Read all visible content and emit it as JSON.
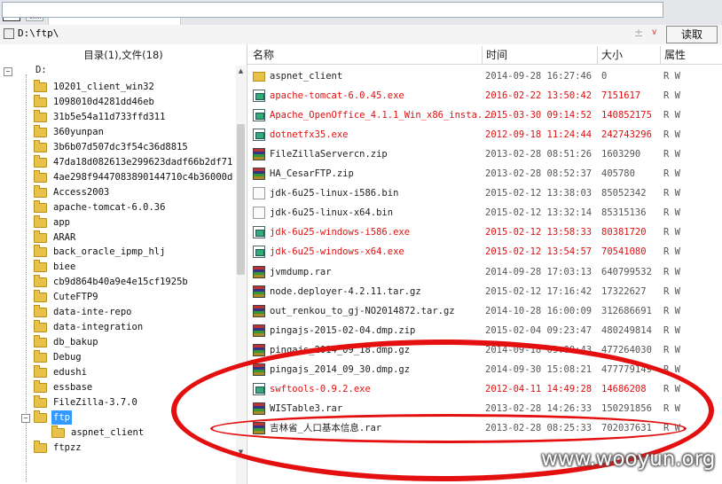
{
  "address": {
    "path": "D:\\ftp\\",
    "read_label": "读取"
  },
  "tree": {
    "header": "目录(1),文件(18)",
    "root_label": "D:",
    "folders": [
      "10201_client_win32",
      "1098010d4281dd46eb",
      "31b5e54a11d733ffd311",
      "360yunpan",
      "3b6b07d507dc3f54c36d8815",
      "47da18d082613e299623dadf66b2df71",
      "4ae298f9447083890144710c4b36000d",
      "Access2003",
      "apache-tomcat-6.0.36",
      "app",
      "ARAR",
      "back_oracle_ipmp_hlj",
      "biee",
      "cb9d864b40a9e4e15cf1925b",
      "CuteFTP9",
      "data-inte-repo",
      "data-integration",
      "db_bakup",
      "Debug",
      "edushi",
      "essbase",
      "FileZilla-3.7.0",
      "ftp",
      "aspnet_client",
      "ftpzz"
    ],
    "selected": "ftp"
  },
  "list": {
    "headers": {
      "name": "名称",
      "time": "时间",
      "size": "大小",
      "attr": "属性"
    },
    "rows": [
      {
        "name": "aspnet_client",
        "time": "2014-09-28 16:27:46",
        "size": "0",
        "attr": "R W",
        "icon": "folder-icon",
        "red": false
      },
      {
        "name": "apache-tomcat-6.0.45.exe",
        "time": "2016-02-22 13:50:42",
        "size": "7151617",
        "attr": "R W",
        "icon": "exe-icon",
        "red": true
      },
      {
        "name": "Apache_OpenOffice_4.1.1_Win_x86_insta...",
        "time": "2015-03-30 09:14:52",
        "size": "140852175",
        "attr": "R W",
        "icon": "exe-icon",
        "red": true
      },
      {
        "name": "dotnetfx35.exe",
        "time": "2012-09-18 11:24:44",
        "size": "242743296",
        "attr": "R W",
        "icon": "exe-icon",
        "red": true
      },
      {
        "name": "FileZillaServercn.zip",
        "time": "2013-02-28 08:51:26",
        "size": "1603290",
        "attr": "R W",
        "icon": "archive-icon",
        "red": false
      },
      {
        "name": "HA_CesarFTP.zip",
        "time": "2013-02-28 08:52:37",
        "size": "405780",
        "attr": "R W",
        "icon": "archive-icon",
        "red": false
      },
      {
        "name": "jdk-6u25-linux-i586.bin",
        "time": "2015-02-12 13:38:03",
        "size": "85052342",
        "attr": "R W",
        "icon": "file-icon",
        "red": false
      },
      {
        "name": "jdk-6u25-linux-x64.bin",
        "time": "2015-02-12 13:32:14",
        "size": "85315136",
        "attr": "R W",
        "icon": "file-icon",
        "red": false
      },
      {
        "name": "jdk-6u25-windows-i586.exe",
        "time": "2015-02-12 13:58:33",
        "size": "80381720",
        "attr": "R W",
        "icon": "exe-icon",
        "red": true
      },
      {
        "name": "jdk-6u25-windows-x64.exe",
        "time": "2015-02-12 13:54:57",
        "size": "70541080",
        "attr": "R W",
        "icon": "exe-icon",
        "red": true
      },
      {
        "name": "jvmdump.rar",
        "time": "2014-09-28 17:03:13",
        "size": "640799532",
        "attr": "R W",
        "icon": "archive-icon",
        "red": false
      },
      {
        "name": "node.deployer-4.2.11.tar.gz",
        "time": "2015-02-12 17:16:42",
        "size": "17322627",
        "attr": "R W",
        "icon": "archive-icon",
        "red": false
      },
      {
        "name": "out_renkou_to_gj-NO2014872.tar.gz",
        "time": "2014-10-28 16:00:09",
        "size": "312686691",
        "attr": "R W",
        "icon": "archive-icon",
        "red": false
      },
      {
        "name": "pingajs-2015-02-04.dmp.zip",
        "time": "2015-02-04 09:23:47",
        "size": "480249814",
        "attr": "R W",
        "icon": "archive-icon",
        "red": false
      },
      {
        "name": "pingajs_2014_09_18.dmp.gz",
        "time": "2014-09-18 09:00:43",
        "size": "477264030",
        "attr": "R W",
        "icon": "archive-icon",
        "red": false
      },
      {
        "name": "pingajs_2014_09_30.dmp.gz",
        "time": "2014-09-30 15:08:21",
        "size": "477779149",
        "attr": "R W",
        "icon": "archive-icon",
        "red": false
      },
      {
        "name": "swftools-0.9.2.exe",
        "time": "2012-04-11 14:49:28",
        "size": "14686208",
        "attr": "R W",
        "icon": "exe-icon",
        "red": true
      },
      {
        "name": "WISTable3.rar",
        "time": "2013-02-28 14:26:33",
        "size": "150291856",
        "attr": "R W",
        "icon": "archive-icon",
        "red": false
      },
      {
        "name": "吉林省_人口基本信息.rar",
        "time": "2013-02-28 08:25:33",
        "size": "702037631",
        "attr": "R W",
        "icon": "archive-icon",
        "red": false
      }
    ]
  },
  "watermark": "www.wooyun.org",
  "colors": {
    "highlight_red": "#e01010",
    "annotation_red": "#e41010",
    "selection_blue": "#3399ff"
  }
}
